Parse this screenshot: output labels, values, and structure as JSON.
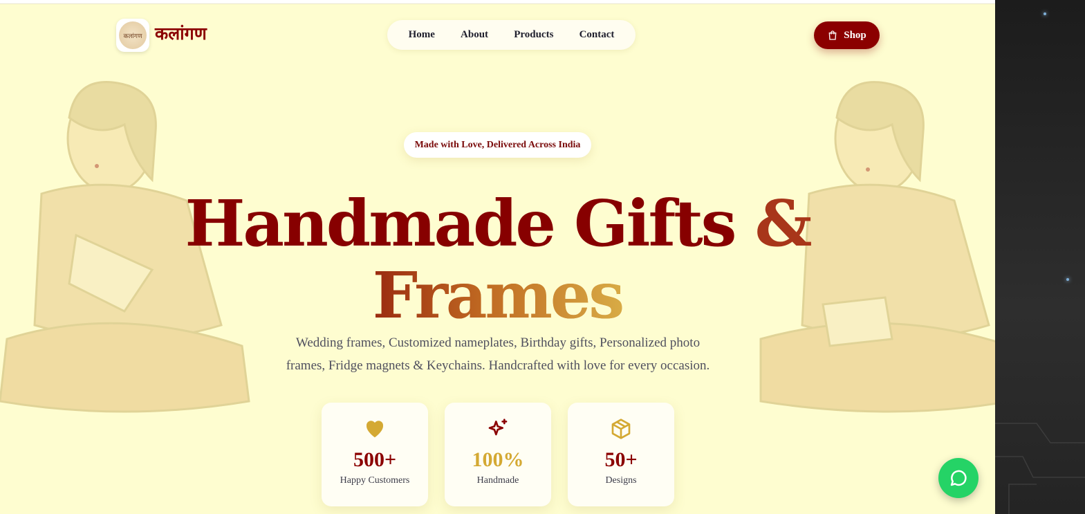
{
  "brand": {
    "name": "कलांगण",
    "logo_text": "कलांगण"
  },
  "nav": {
    "items": [
      "Home",
      "About",
      "Products",
      "Contact"
    ]
  },
  "shop_button": {
    "label": "Shop",
    "icon": "shopping-bag-icon"
  },
  "hero": {
    "badge": "Made with Love, Delivered Across India",
    "title_line1": "Handmade Gifts",
    "title_amp": "&",
    "title_line2": "Frames",
    "subtitle_line1": "Wedding frames, Customized nameplates, Birthday gifts, Personalized photo",
    "subtitle_line2": "frames, Fridge magnets & Keychains. Handcrafted with love for every occasion."
  },
  "stats": [
    {
      "value": "500+",
      "label": "Happy Customers",
      "icon": "heart-icon",
      "color": "#8b0000",
      "icon_color": "#d4a933"
    },
    {
      "value": "100%",
      "label": "Handmade",
      "icon": "sparkles-icon",
      "color": "#d4a933",
      "icon_color": "#8b0000"
    },
    {
      "value": "50+",
      "label": "Designs",
      "icon": "package-icon",
      "color": "#8b0000",
      "icon_color": "#d4a933"
    }
  ],
  "whatsapp": {
    "icon": "whatsapp-icon",
    "color": "#25d366"
  },
  "colors": {
    "primary": "#8b0000",
    "gold": "#d4a933",
    "background": "#fefdd0"
  }
}
